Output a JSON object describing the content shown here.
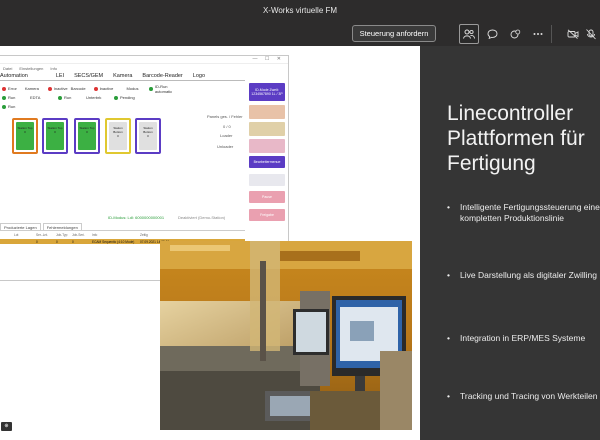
{
  "window": {
    "title": "X-Works virtuelle FM"
  },
  "toolbar": {
    "control_button": "Steuerung anfordern",
    "icons": [
      "participants-icon",
      "chat-icon",
      "reactions-icon",
      "more-icon",
      "camera-off-icon",
      "mic-off-icon"
    ]
  },
  "slide": {
    "title_lines": [
      "Linecontroller",
      "Plattformen für",
      "Fertigung"
    ],
    "bullets": [
      "Intelligente Fertigungssteuerung einer kompletten Produktionslinie",
      "Live Darstellung als digitaler Zwilling",
      "Integration in ERP/MES Systeme",
      "Tracking und Tracing von Werkteilen"
    ]
  },
  "app": {
    "menu": [
      "Datei",
      "Einstellungen",
      "Info"
    ],
    "tabs": [
      "Automation",
      "LEI",
      "SECS/GEM",
      "Kamera",
      "Barcode-Reader",
      "Logo"
    ],
    "status": [
      [
        "Error",
        "Kamera",
        "Inactive",
        "Barcode",
        "Inactive",
        "Modus",
        "ID-Run automatic"
      ],
      [
        "Run",
        "EDTA",
        "Run",
        "Unterbrk",
        "Pending"
      ],
      [
        "Run"
      ]
    ],
    "stations": [
      {
        "title": "Station Top",
        "value": "0"
      },
      {
        "title": "Station Top",
        "value": "0"
      },
      {
        "title": "Station Top",
        "value": "0"
      },
      {
        "title": "Station Bottom",
        "value": "0"
      },
      {
        "title": "Station Bottom",
        "value": "0"
      }
    ],
    "counters": {
      "label": "Panels ges. / Fehler",
      "value": "0 / 0",
      "loader": "Loader",
      "unloader": "Unloader"
    },
    "side_buttons": [
      "ID-Mode Zweit: 1234567890 1L / 3P",
      "",
      "",
      "",
      "Bearbeitermenue",
      "",
      "Pause",
      "Freigabe"
    ],
    "footer_status": [
      "ID-Modus: Ldl: 6000000000001",
      "Deaktiviert (Demo-Station)"
    ],
    "table_tabs": [
      "Produzierte Lagen",
      "Fehlermeldungen"
    ],
    "table_head": [
      "Lot",
      "Ser.-Lnt.",
      "Job-Typ",
      "Job-Seri.",
      "Info",
      "Zeitig"
    ],
    "table_row": [
      "",
      "0",
      "0",
      "0",
      "ECAM Sequentic (4:10 Mode)",
      "07.09.2021 14:09:01"
    ]
  },
  "colors": {
    "accent": "#5b3cc4",
    "orange": "#d9a63a",
    "panel": "#353535",
    "topbar": "#2d2c2c"
  }
}
